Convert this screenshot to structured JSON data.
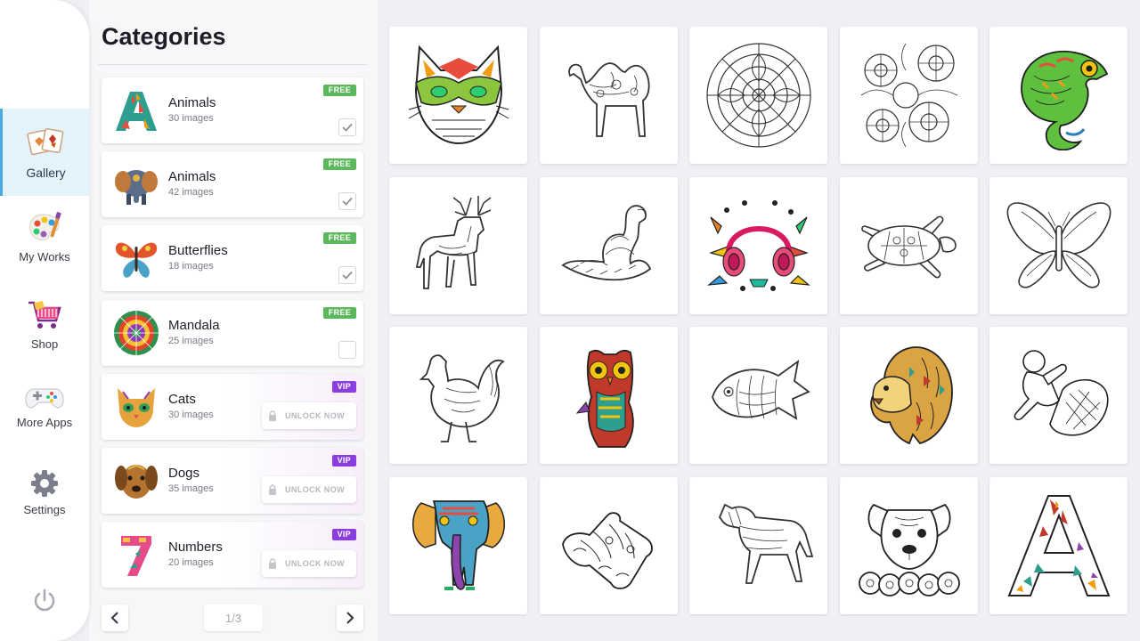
{
  "nav": {
    "items": [
      {
        "label": "Gallery",
        "icon": "gallery-icon",
        "active": true
      },
      {
        "label": "My Works",
        "icon": "palette-icon"
      },
      {
        "label": "Shop",
        "icon": "shopping-cart-icon"
      },
      {
        "label": "More Apps",
        "icon": "gamepad-icon"
      },
      {
        "label": "Settings",
        "icon": "gear-icon"
      }
    ],
    "power_icon": "power-icon"
  },
  "categories": {
    "title": "Categories",
    "unlock_label": "UNLOCK NOW",
    "items": [
      {
        "name": "Animals",
        "count": "30 images",
        "badge": "FREE",
        "checked": true
      },
      {
        "name": "Animals",
        "count": "42 images",
        "badge": "FREE",
        "checked": true
      },
      {
        "name": "Butterflies",
        "count": "18 images",
        "badge": "FREE",
        "checked": true
      },
      {
        "name": "Mandala",
        "count": "25 images",
        "badge": "FREE",
        "checked": false
      },
      {
        "name": "Cats",
        "count": "30 images",
        "badge": "VIP"
      },
      {
        "name": "Dogs",
        "count": "35 images",
        "badge": "VIP"
      },
      {
        "name": "Numbers",
        "count": "20 images",
        "badge": "VIP"
      }
    ],
    "pager": {
      "indicator": "1/3"
    }
  },
  "gallery": {
    "tiles": [
      {
        "subject": "cat-mask"
      },
      {
        "subject": "camel"
      },
      {
        "subject": "mandala"
      },
      {
        "subject": "flowers"
      },
      {
        "subject": "chameleon"
      },
      {
        "subject": "deer"
      },
      {
        "subject": "swan"
      },
      {
        "subject": "headphones"
      },
      {
        "subject": "turtle"
      },
      {
        "subject": "butterfly"
      },
      {
        "subject": "rooster"
      },
      {
        "subject": "owl"
      },
      {
        "subject": "fish"
      },
      {
        "subject": "lion"
      },
      {
        "subject": "cupid"
      },
      {
        "subject": "elephant"
      },
      {
        "subject": "hands"
      },
      {
        "subject": "horse"
      },
      {
        "subject": "dog"
      },
      {
        "subject": "letter-a"
      }
    ]
  },
  "colors": {
    "accent": "#4aa9e0",
    "free_badge": "#5cb85c",
    "vip_badge": "#8a3ee0"
  }
}
